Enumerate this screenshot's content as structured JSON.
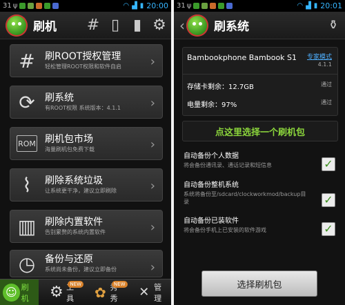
{
  "left": {
    "status": {
      "battery": "31",
      "time": "20:00"
    },
    "header": {
      "title": "刷机"
    },
    "menu": [
      {
        "title": "刷ROOT授权管理",
        "subtitle": "轻松管理ROOT权限和软件自启",
        "icon": "hash-icon"
      },
      {
        "title": "刷系统",
        "subtitle": "有ROOT权限 系统版本：4.1.1",
        "icon": "android-refresh-icon"
      },
      {
        "title": "刷机包市场",
        "subtitle": "海量刷机包免费下载",
        "icon": "rom-icon"
      },
      {
        "title": "刷除系统垃圾",
        "subtitle": "让系统更干净，建议立即刷除",
        "icon": "broom-icon"
      },
      {
        "title": "刷除内置软件",
        "subtitle": "告别累赘的系统内置软件",
        "icon": "trash-icon"
      },
      {
        "title": "备份与还原",
        "subtitle": "系统尚未备份，建议立即备份",
        "icon": "history-icon"
      }
    ],
    "nav": [
      {
        "label": "刷机",
        "badge": ""
      },
      {
        "label": "工具",
        "badge": "NEW"
      },
      {
        "label": "秀秀",
        "badge": "NEW"
      },
      {
        "label": "管理",
        "badge": ""
      }
    ]
  },
  "right": {
    "status": {
      "battery": "31",
      "time": "20:01"
    },
    "header": {
      "title": "刷系统"
    },
    "device": {
      "name": "Bambookphone Bambook S1",
      "expert_link": "专家模式",
      "version": "4.1.1",
      "storage_label": "存储卡剩余：12.7GB",
      "storage_status": "通过",
      "battery_label": "电量剩余：97%",
      "battery_status": "通过"
    },
    "select_link": "点这里选择一个刷机包",
    "options": [
      {
        "title": "自动备份个人数据",
        "subtitle": "将会备份通讯录、通话记录和短信息",
        "checked": true
      },
      {
        "title": "自动备份整机系统",
        "subtitle": "系统将备份至/sdcard/clockworkmod/backup目录",
        "checked": true
      },
      {
        "title": "自动备份已装软件",
        "subtitle": "将会备份手机上已安装的软件游戏",
        "checked": true
      }
    ],
    "footer_button": "选择刷机包"
  }
}
